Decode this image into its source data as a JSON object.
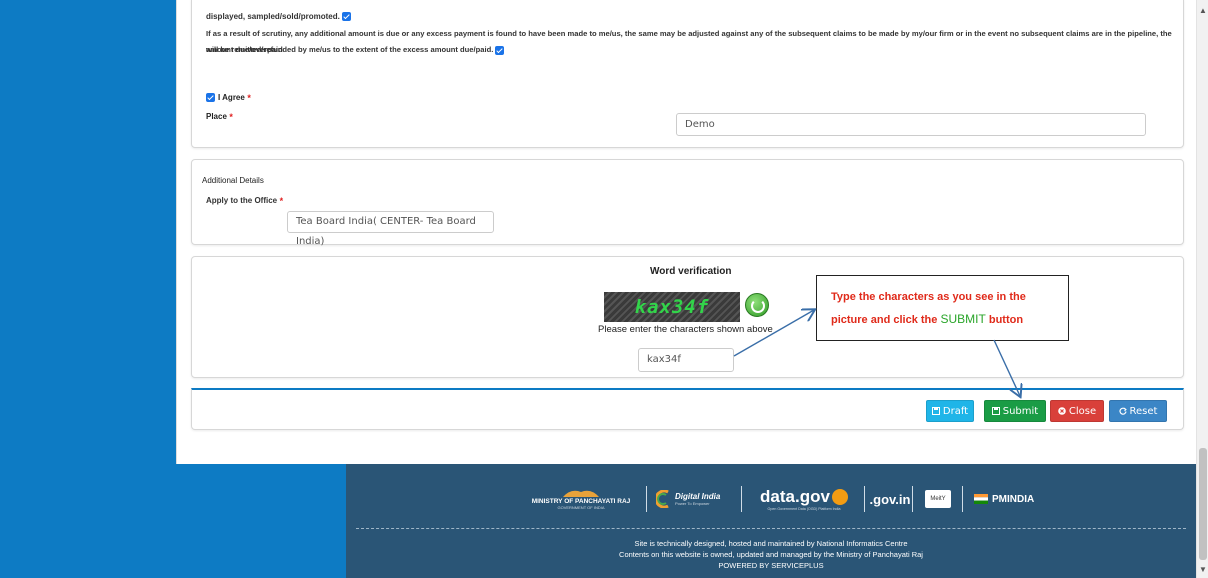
{
  "declaration": {
    "line1": "displayed, sampled/sold/promoted.",
    "line2": "If as a result of scrutiny, any additional amount is due or any excess payment is found to have been made to me/us, the same may be adjusted against any of the subsequent claims to be made by my/our firm or in the event no subsequent claims are in the pipeline, the amount due/overpaid",
    "line3": "will be remitted/refunded by me/us to the extent of the excess amount due/paid.",
    "agree_label": "I Agree",
    "place_label": "Place",
    "place_value": "Demo"
  },
  "additional": {
    "title": "Additional Details",
    "office_label": "Apply to the Office",
    "office_value": "Tea Board India( CENTER- Tea Board India)"
  },
  "verification": {
    "title": "Word verification",
    "captcha_text": "kax34f",
    "hint": "Please enter the characters shown above",
    "input_value": "kax34f"
  },
  "callout": {
    "line1": "Type the characters as you see in the",
    "line2_prefix": "picture and click the",
    "line2_highlight": "SUBMIT",
    "line2_suffix": "button"
  },
  "buttons": {
    "draft": "Draft",
    "submit": "Submit",
    "close": "Close",
    "reset": "Reset"
  },
  "footer": {
    "logos": {
      "panchayati_raj": "MINISTRY OF PANCHAYATI RAJ",
      "panchayati_raj_sub": "GOVERNMENT OF INDIA",
      "digital_india": "Digital India",
      "digital_india_sub": "Power To Empower",
      "data_gov": "data.gov",
      "data_gov_sub": "Open Government Data (OGD) Platform India",
      "india_gov": ".gov.in",
      "meity": "MeitY",
      "pmindia": "PMINDIA"
    },
    "line1": "Site is technically designed, hosted and maintained by National Informatics Centre",
    "line2": "Contents on this website is owned, updated and managed by the Ministry of Panchayati Raj",
    "line3": "POWERED BY SERVICEPLUS"
  },
  "colors": {
    "sidebar": "#0d7bc4",
    "footer": "#2a5576",
    "draft": "#1fb5e8",
    "submit": "#1a9c45",
    "close": "#d9403a",
    "reset": "#3b86c6",
    "callout_text": "#e02a1a",
    "callout_highlight": "#2aa52a"
  }
}
